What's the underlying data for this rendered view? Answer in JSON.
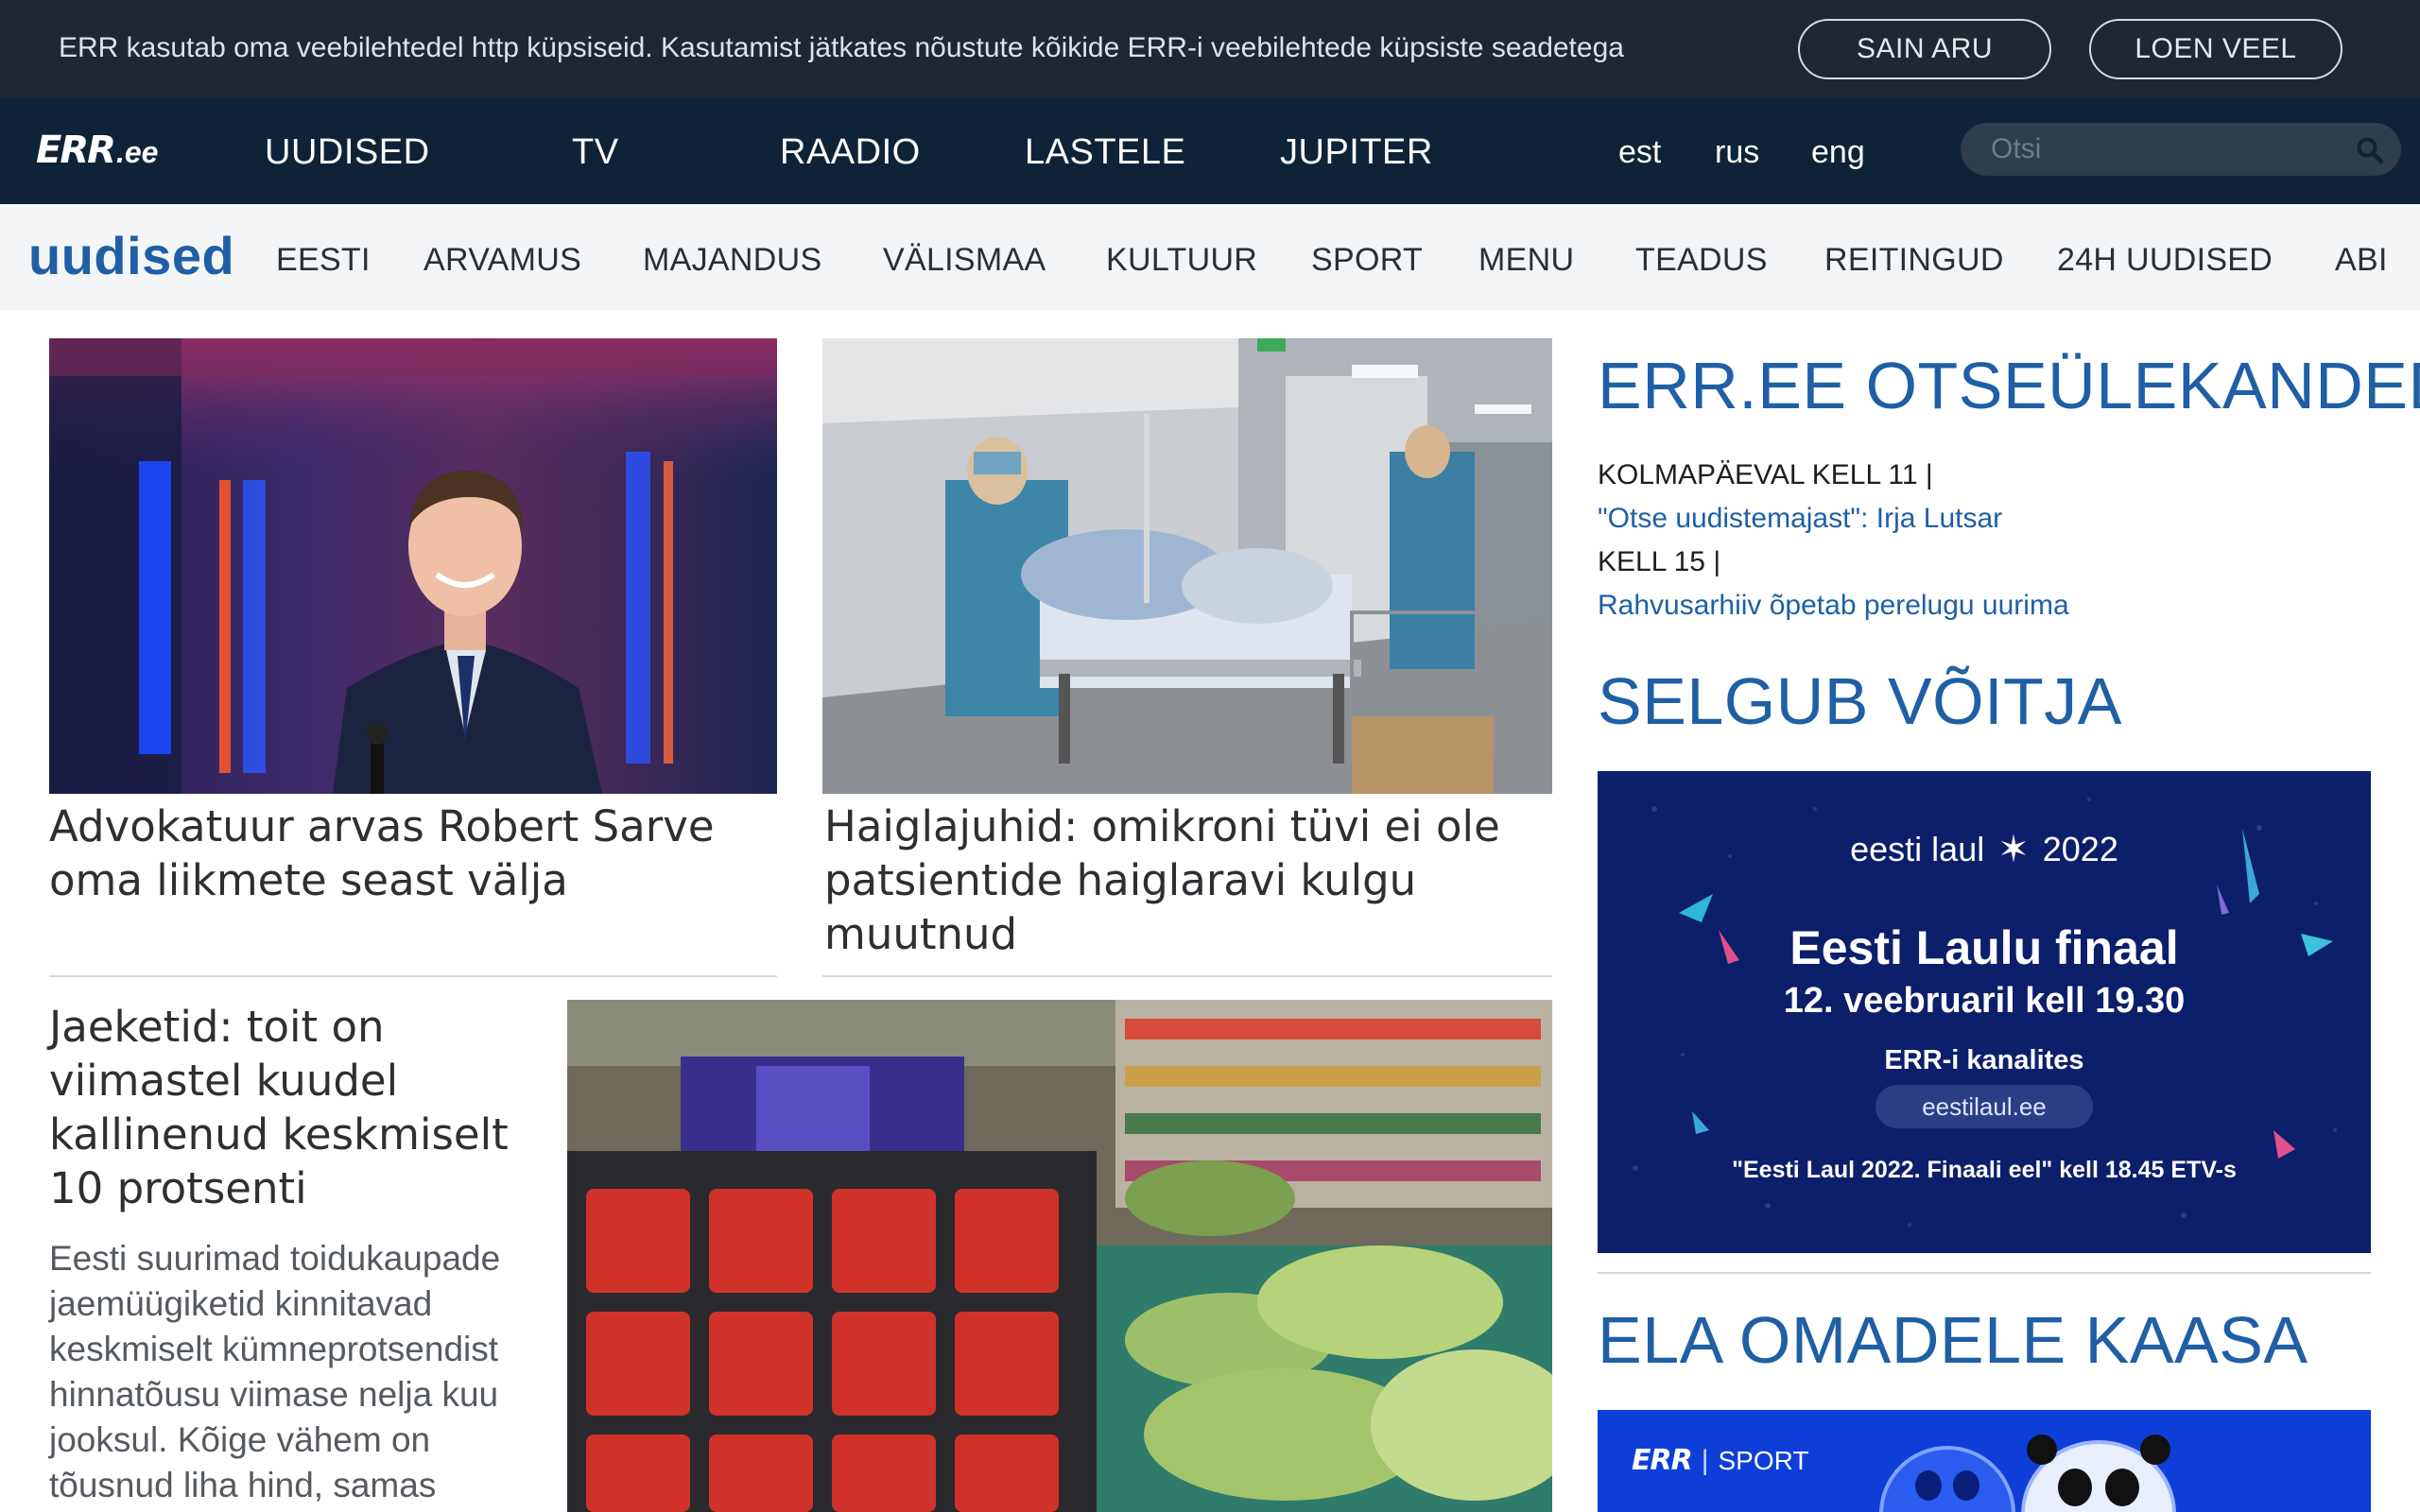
{
  "cookie_bar": {
    "text": "ERR kasutab oma veebilehtedel http küpsiseid. Kasutamist jätkates nõustute kõikide ERR-i veebilehtede küpsiste seadetega",
    "accept_label": "SAIN ARU",
    "more_label": "LOEN VEEL"
  },
  "top_nav": {
    "logo_main": "ERR",
    "logo_suffix": ".ee",
    "items": [
      "UUDISED",
      "TV",
      "RAADIO",
      "LASTELE",
      "JUPITER"
    ],
    "languages": [
      "est",
      "rus",
      "eng"
    ],
    "search_placeholder": "Otsi"
  },
  "sub_nav": {
    "section": "uudised",
    "items": [
      "EESTI",
      "ARVAMUS",
      "MAJANDUS",
      "VÄLISMAA",
      "KULTUUR",
      "SPORT",
      "MENU",
      "TEADUS",
      "REITINGUD",
      "24H UUDISED",
      "ABI"
    ]
  },
  "articles": [
    {
      "headline": "Advokatuur arvas Robert Sarve oma liikmete seast välja"
    },
    {
      "headline": "Haiglajuhid: omikroni tüvi ei ole patsientide haiglaravi kulgu muutnud"
    },
    {
      "headline": "Jaeketid: toit on viimastel kuudel kallinenud keskmiselt 10 protsenti",
      "lead": "Eesti suurimad toidukaupade jaemüügiketid kinnitavad keskmiselt kümneprotsendist hinnatõusu viimase nelja kuu jooksul. Kõige vähem on tõusnud liha hind, samas"
    }
  ],
  "sidebar": {
    "live_heading": "ERR.EE OTSEÜLEKANDED",
    "live_items": [
      {
        "time": "KOLMAPÄEVAL KELL 11 |",
        "title": "\"Otse uudistemajast\": Irja Lutsar"
      },
      {
        "time": "KELL 15 |",
        "title": "Rahvusarhiiv õpetab perelugu uurima"
      }
    ],
    "winner_heading": "SELGUB VÕITJA",
    "promo": {
      "brand": "eesti laul",
      "year": "2022",
      "title": "Eesti Laulu finaal",
      "date": "12. veebruaril kell 19.30",
      "channels": "ERR-i kanalites",
      "site": "eestilaul.ee",
      "footer": "\"Eesti Laul 2022. Finaali eel\" kell 18.45 ETV-s"
    },
    "support_heading": "ELA OMADELE KAASA",
    "sport_banner": {
      "brand": "ERR",
      "label": "SPORT"
    }
  },
  "colors": {
    "top_nav": "#0e2238",
    "cookie_bar": "#1f2732",
    "accent": "#1f5fa5",
    "promo_bg": "#0c1f6b"
  }
}
